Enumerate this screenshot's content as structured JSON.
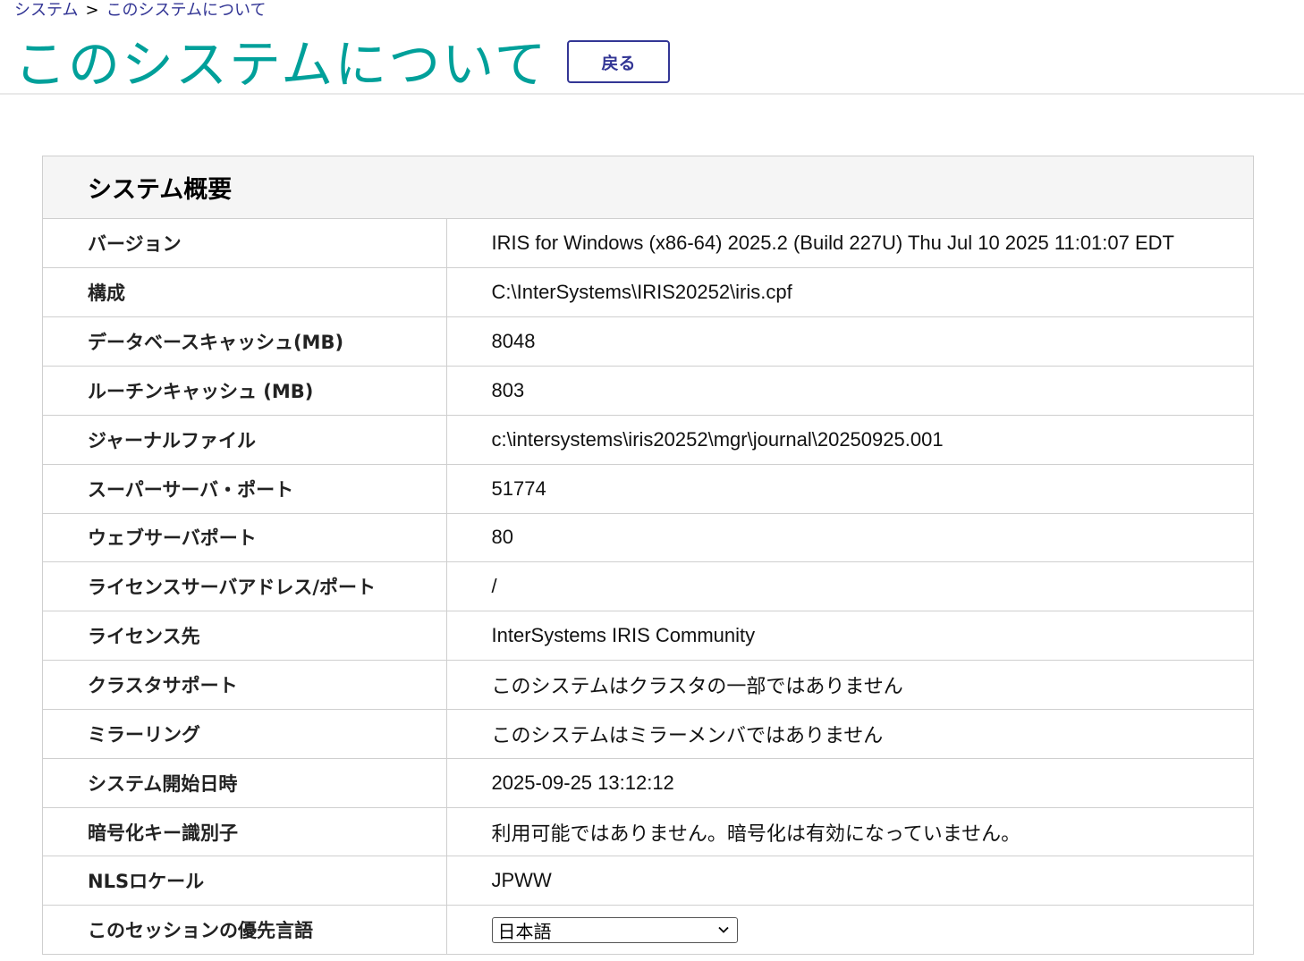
{
  "breadcrumb": {
    "items": [
      "システム",
      "このシステムについて"
    ],
    "separator": ">"
  },
  "header": {
    "title": "このシステムについて",
    "back_label": "戻る"
  },
  "panel": {
    "title": "システム概要",
    "rows": [
      {
        "label": "バージョン",
        "value": "IRIS for Windows (x86-64) 2025.2 (Build 227U) Thu Jul 10 2025 11:01:07 EDT"
      },
      {
        "label": "構成",
        "value": "C:\\InterSystems\\IRIS20252\\iris.cpf"
      },
      {
        "label": "データベースキャッシュ(MB)",
        "value": "8048"
      },
      {
        "label": "ルーチンキャッシュ (MB)",
        "value": "803"
      },
      {
        "label": "ジャーナルファイル",
        "value": "c:\\intersystems\\iris20252\\mgr\\journal\\20250925.001"
      },
      {
        "label": "スーパーサーバ・ポート",
        "value": "51774"
      },
      {
        "label": "ウェブサーバポート",
        "value": "80"
      },
      {
        "label": "ライセンスサーバアドレス/ポート",
        "value": "/"
      },
      {
        "label": "ライセンス先",
        "value": "InterSystems IRIS Community"
      },
      {
        "label": "クラスタサポート",
        "value": "このシステムはクラスタの一部ではありません"
      },
      {
        "label": "ミラーリング",
        "value": "このシステムはミラーメンバではありません"
      },
      {
        "label": "システム開始日時",
        "value": "2025-09-25 13:12:12"
      },
      {
        "label": "暗号化キー識別子",
        "value": "利用可能ではありません。暗号化は有効になっていません。"
      },
      {
        "label": "NLSロケール",
        "value": "JPWW"
      },
      {
        "label": "このセッションの優先言語",
        "value": "日本語"
      }
    ]
  },
  "colors": {
    "title": "#00a09a",
    "link": "#333695",
    "highlight": "#ffe600"
  },
  "icons": {
    "select_arrow": "chevron-down-icon"
  }
}
